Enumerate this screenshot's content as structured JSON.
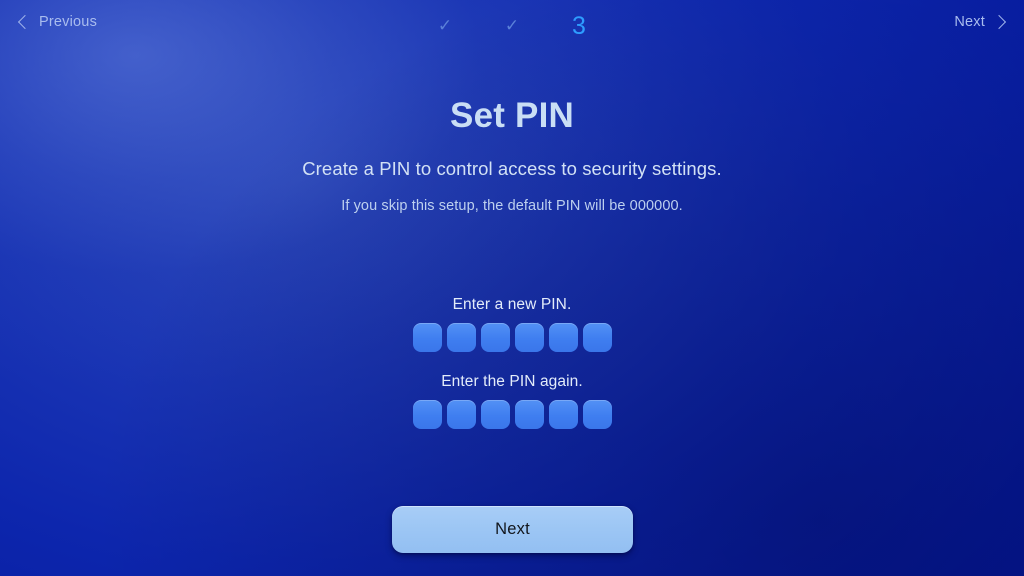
{
  "topbar": {
    "previous_label": "Previous",
    "next_label": "Next",
    "steps": [
      {
        "type": "check",
        "glyph": "✓",
        "state": "completed"
      },
      {
        "type": "check",
        "glyph": "✓",
        "state": "completed"
      },
      {
        "type": "number",
        "glyph": "3",
        "state": "current"
      }
    ]
  },
  "main": {
    "title": "Set PIN",
    "subtitle": "Create a PIN to control access to security settings.",
    "note": "If you skip this setup, the default PIN will be 000000.",
    "pin_sections": [
      {
        "label": "Enter a new PIN.",
        "digits": 6,
        "value": ""
      },
      {
        "label": "Enter the PIN again.",
        "digits": 6,
        "value": ""
      }
    ]
  },
  "footer": {
    "next_button_label": "Next"
  },
  "colors": {
    "background_top_left": "#2a46b8",
    "background_bottom_right": "#00127e",
    "title_text": "#c9def5",
    "current_step": "#2e9dff",
    "completed_step": "#5a80d8",
    "pin_box": "#3f7ef0",
    "primary_button": "#9cc6f4",
    "primary_button_text": "#12161c",
    "nav_link": "#a9bcee"
  }
}
